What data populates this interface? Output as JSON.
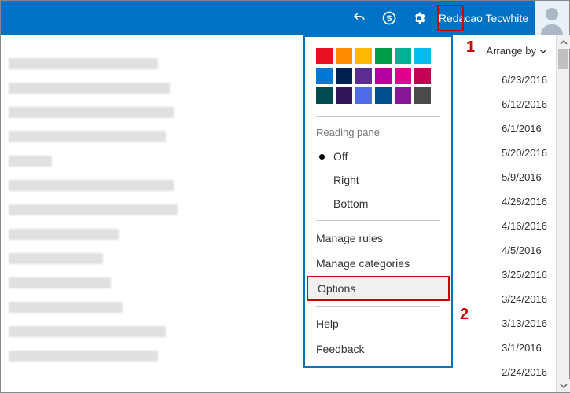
{
  "header": {
    "username": "Redacao Tecwhite"
  },
  "arrange_by_label": "Arrange by",
  "callouts": {
    "c1": "1",
    "c2": "2"
  },
  "dates": [
    "6/23/2016",
    "6/12/2016",
    "6/1/2016",
    "5/20/2016",
    "5/9/2016",
    "4/28/2016",
    "4/16/2016",
    "4/5/2016",
    "3/25/2016",
    "3/24/2016",
    "3/13/2016",
    "3/1/2016",
    "2/24/2016"
  ],
  "message_widths": [
    190,
    205,
    210,
    200,
    55,
    210,
    215,
    140,
    120,
    130,
    145,
    200,
    190
  ],
  "dropdown": {
    "colors": [
      "#e81123",
      "#ff8c00",
      "#ffb900",
      "#009e49",
      "#00b294",
      "#00bcf2",
      "#0078d7",
      "#002050",
      "#5c2d91",
      "#b4009e",
      "#e3008c",
      "#c30052",
      "#004b50",
      "#32145a",
      "#4f6bed",
      "#004e8c",
      "#881798",
      "#4c4a48"
    ],
    "reading_pane_title": "Reading pane",
    "reading_pane": {
      "off": "Off",
      "right": "Right",
      "bottom": "Bottom"
    },
    "manage_rules": "Manage rules",
    "manage_categories": "Manage categories",
    "options": "Options",
    "help": "Help",
    "feedback": "Feedback"
  }
}
